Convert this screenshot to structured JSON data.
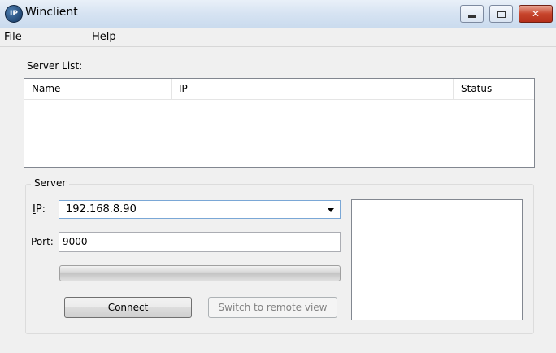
{
  "window": {
    "title": "Winclient",
    "icon_text": "IP"
  },
  "menu": [
    {
      "mnemonic": "F",
      "rest": "ile"
    },
    {
      "mnemonic": "H",
      "rest": "elp"
    }
  ],
  "server_list": {
    "label": "Server List:",
    "columns": [
      "Name",
      "IP",
      "Status"
    ]
  },
  "server_group": {
    "title": "Server",
    "ip_label_mnemonic": "I",
    "ip_label_rest": "P:",
    "ip_value": "192.168.8.90",
    "port_label_mnemonic": "P",
    "port_label_rest": "ort:",
    "port_value": "9000",
    "connect_label": "Connect",
    "switch_label": "Switch to remote view"
  },
  "icons": {
    "minimize": "minimize-icon",
    "maximize": "maximize-icon",
    "close": "close-icon"
  }
}
